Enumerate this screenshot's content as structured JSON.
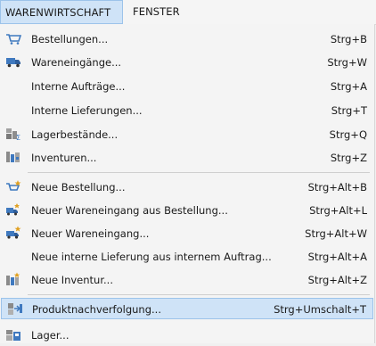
{
  "menubar": {
    "items": [
      {
        "label": "WARENWIRTSCHAFT"
      },
      {
        "label": "FENSTER"
      }
    ]
  },
  "menu": {
    "items": [
      {
        "label": "Bestellungen...",
        "shortcut": "Strg+B",
        "icon": "orders-cart-icon"
      },
      {
        "label": "Wareneingänge...",
        "shortcut": "Strg+W",
        "icon": "delivery-truck-icon"
      },
      {
        "label": "Interne Aufträge...",
        "shortcut": "Strg+A",
        "icon": ""
      },
      {
        "label": "Interne Lieferungen...",
        "shortcut": "Strg+T",
        "icon": ""
      },
      {
        "label": "Lagerbestände...",
        "shortcut": "Strg+Q",
        "icon": "stock-boxes-sum-icon"
      },
      {
        "label": "Inventuren...",
        "shortcut": "Strg+Z",
        "icon": "inventory-shelf-icon"
      },
      {
        "label": "Neue Bestellung...",
        "shortcut": "Strg+Alt+B",
        "icon": "new-order-cart-icon"
      },
      {
        "label": "Neuer Wareneingang aus Bestellung...",
        "shortcut": "Strg+Alt+L",
        "icon": "goods-receipt-from-order-icon"
      },
      {
        "label": "Neuer Wareneingang...",
        "shortcut": "Strg+Alt+W",
        "icon": "new-delivery-truck-icon"
      },
      {
        "label": "Neue interne Lieferung aus internem Auftrag...",
        "shortcut": "Strg+Alt+A",
        "icon": ""
      },
      {
        "label": "Neue Inventur...",
        "shortcut": "Strg+Alt+Z",
        "icon": "new-inventory-icon"
      },
      {
        "label": "Produktnachverfolgung...",
        "shortcut": "Strg+Umschalt+T",
        "icon": "product-tracking-icon"
      },
      {
        "label": "Lager...",
        "shortcut": "",
        "icon": "warehouse-icon"
      }
    ]
  },
  "colors": {
    "highlight_bg": "#cfe3f7",
    "highlight_border": "#9cc3ea",
    "menu_bg": "#f4f4f4",
    "icon_blue": "#3f79bf"
  }
}
